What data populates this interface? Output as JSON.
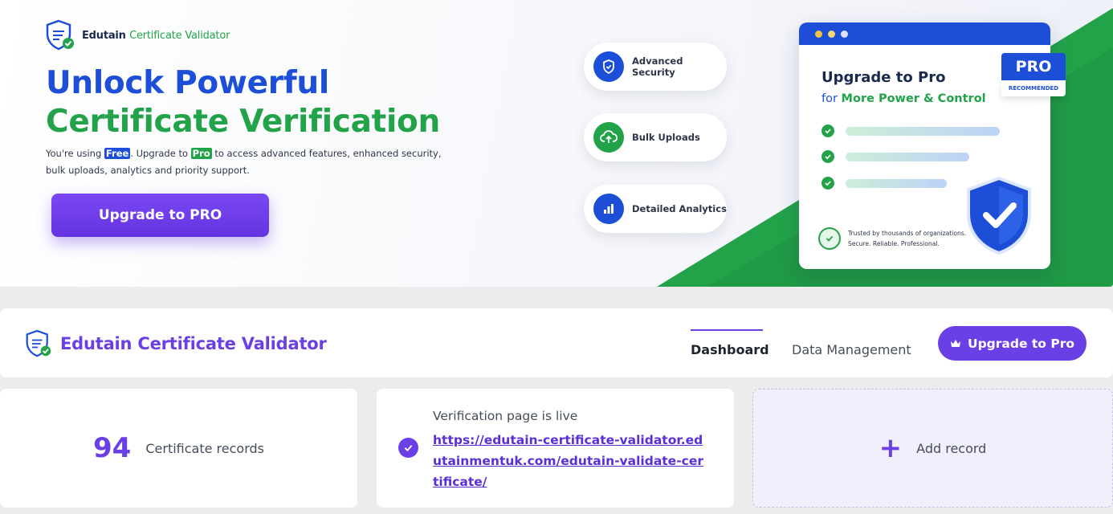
{
  "hero": {
    "logo_name": "Edutain",
    "logo_suffix": "Certificate Validator",
    "title_line1": "Unlock Powerful",
    "title_line2": "Certificate Verification",
    "desc_prefix": "You're using",
    "desc_free": "Free",
    "desc_mid": ". Upgrade to",
    "desc_pro": "Pro",
    "desc_rest": "to access advanced features, enhanced security, bulk uploads, analytics and priority support.",
    "cta_label": "Upgrade to PRO",
    "features": [
      {
        "label": "Advanced Security",
        "icon": "shield-icon"
      },
      {
        "label": "Bulk Uploads",
        "icon": "cloud-upload-icon"
      },
      {
        "label": "Detailed Analytics",
        "icon": "bar-chart-icon"
      }
    ],
    "card": {
      "title": "Upgrade to Pro",
      "sub_prefix": "for",
      "sub_highlight": "More Power & Control",
      "ribbon_label": "PRO",
      "ribbon_sub": "RECOMMENDED",
      "trust_line1": "Trusted by thousands of organizations.",
      "trust_line2": "Secure. Reliable. Professional."
    },
    "colors": {
      "blue": "#1d4ed8",
      "green": "#22a34a",
      "purple": "#6b3fe6"
    }
  },
  "nav": {
    "brand": "Edutain Certificate Validator",
    "tabs": [
      {
        "label": "Dashboard",
        "active": true
      },
      {
        "label": "Data Management",
        "active": false
      }
    ],
    "upgrade_label": "Upgrade to Pro"
  },
  "stats": {
    "count": "94",
    "count_label": "Certificate records",
    "live_title": "Verification page is live",
    "live_link": "https://edutain-certificate-validator.edutainmentuk.com/edutain-validate-certificate/",
    "add_label": "Add record"
  }
}
